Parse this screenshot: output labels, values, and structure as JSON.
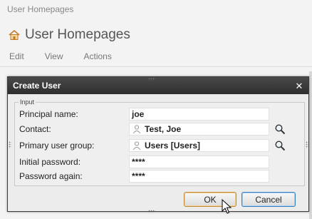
{
  "background": {
    "breadcrumb": "User Homepages",
    "title": "User Homepages",
    "menu": [
      "Edit",
      "View",
      "Actions"
    ]
  },
  "dialog": {
    "title": "Create User",
    "fieldset_legend": "Input",
    "fields": {
      "principal_name": {
        "label": "Principal name:",
        "value": "joe"
      },
      "contact": {
        "label": "Contact:",
        "value": "Test, Joe"
      },
      "primary_group": {
        "label": "Primary user group:",
        "value": "Users [Users]"
      },
      "initial_password": {
        "label": "Initial password:",
        "value": "****"
      },
      "password_again": {
        "label": "Password again:",
        "value": "****"
      }
    },
    "ok_label": "OK",
    "cancel_label": "Cancel"
  },
  "colors": {
    "dialog_header": "#2e2e2e",
    "ok_border": "#c08a3a",
    "cancel_border": "#3a7fbf"
  }
}
